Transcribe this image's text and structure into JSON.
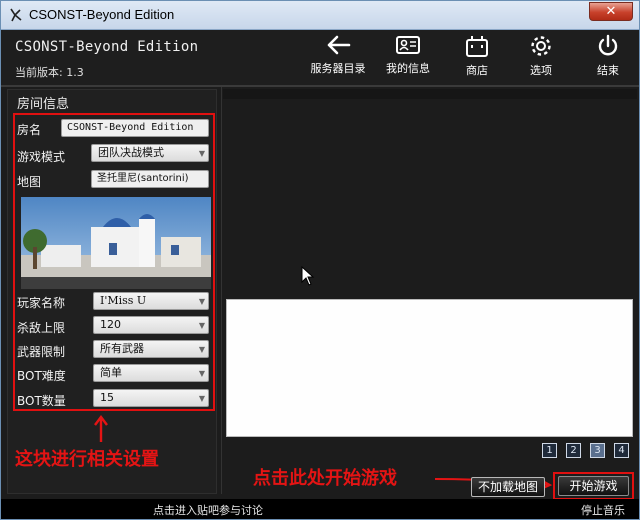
{
  "window": {
    "title": "CSONST-Beyond Edition",
    "close_glyph": "✕"
  },
  "header": {
    "app_name": "CSONST-Beyond Edition",
    "version": "当前版本: 1.3",
    "tools": [
      {
        "label": "服务器目录",
        "icon": "arrow-left-icon"
      },
      {
        "label": "我的信息",
        "icon": "id-card-icon"
      },
      {
        "label": "商店",
        "icon": "shop-icon"
      },
      {
        "label": "选项",
        "icon": "gear-icon"
      },
      {
        "label": "结束",
        "icon": "power-icon"
      }
    ]
  },
  "room": {
    "panel_title": "房间信息",
    "name_label": "房名",
    "name_value": "CSONST-Beyond Edition",
    "mode_label": "游戏模式",
    "mode_value": "团队决战模式",
    "map_label": "地图",
    "map_value": "圣托里尼(santorini)",
    "player_label": "玩家名称",
    "player_value": "I'Miss U",
    "kill_label": "杀敌上限",
    "kill_value": "120",
    "weapon_label": "武器限制",
    "weapon_value": "所有武器",
    "bot_diff_label": "BOT难度",
    "bot_diff_value": "简单",
    "bot_count_label": "BOT数量",
    "bot_count_value": "15"
  },
  "pagination": [
    "1",
    "2",
    "3",
    "4"
  ],
  "pagination_active": "3",
  "buttons": {
    "no_load_map": "不加载地图",
    "start_game": "开始游戏"
  },
  "annotations": {
    "left_settings": "这块进行相关设置",
    "start_hint": "点击此处开始游戏"
  },
  "footer": {
    "forum_link": "点击进入贴吧参与讨论",
    "stop_music": "停止音乐"
  },
  "colors": {
    "annotation_red": "#e41414",
    "panel_bg": "#1c1c1c"
  }
}
